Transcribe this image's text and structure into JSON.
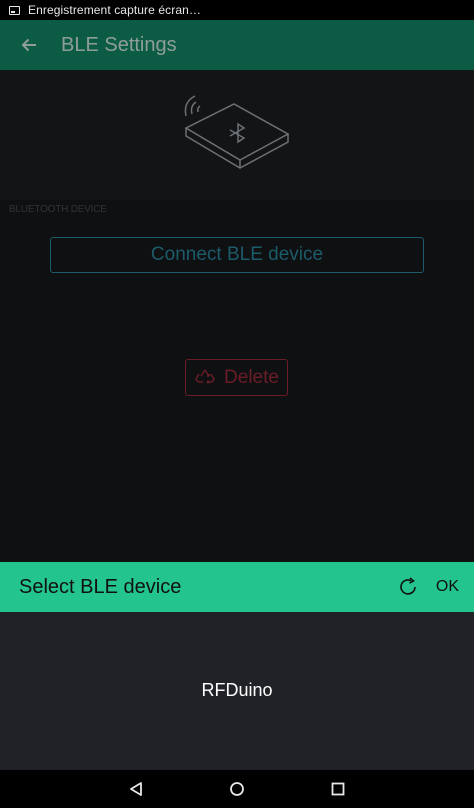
{
  "status_bar": {
    "notification_icon": "screenshot-icon",
    "text": "Enregistrement capture écran…"
  },
  "app_bar": {
    "back_icon": "arrow-left-icon",
    "title": "BLE Settings"
  },
  "hero": {
    "icon": "ble-device-icon"
  },
  "section": {
    "label": "BLUETOOTH DEVICE"
  },
  "connect_button": {
    "label": "Connect BLE device"
  },
  "delete_button": {
    "icon": "recycle-icon",
    "label": "Delete"
  },
  "sheet": {
    "title": "Select BLE device",
    "refresh_icon": "refresh-icon",
    "ok_label": "OK",
    "devices": [
      {
        "name": "RFDuino"
      }
    ]
  },
  "nav_bar": {
    "back_icon": "nav-back-icon",
    "home_icon": "nav-home-icon",
    "recents_icon": "nav-recents-icon"
  },
  "colors": {
    "app_bar": "#0c5c45",
    "sheet_header": "#23c48e",
    "connect_border": "#1c5b6a",
    "delete_border": "#6b1d27",
    "sheet_body": "#212227"
  }
}
